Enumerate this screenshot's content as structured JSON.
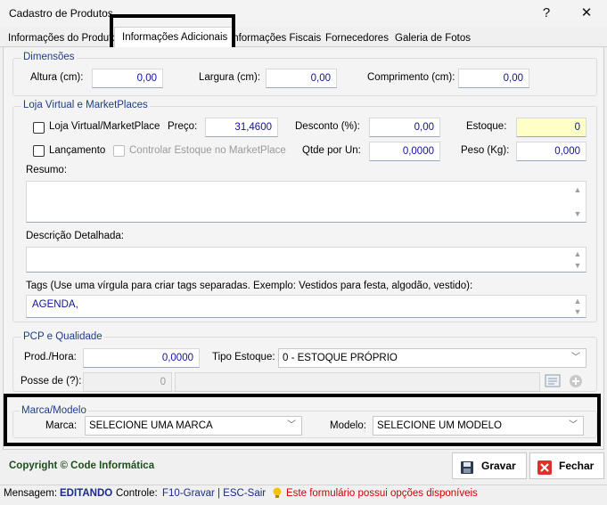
{
  "window": {
    "title": "Cadastro de Produtos",
    "help_label": "?",
    "close_label": "✕"
  },
  "tabs": [
    {
      "label": "Informações do Produto"
    },
    {
      "label": "Informações Adicionais",
      "active": true
    },
    {
      "label": "Informações Fiscais"
    },
    {
      "label": "Fornecedores"
    },
    {
      "label": "Galeria de Fotos"
    }
  ],
  "dimensoes": {
    "title": "Dimensões",
    "altura_label": "Altura (cm):",
    "altura_value": "0,00",
    "largura_label": "Largura (cm):",
    "largura_value": "0,00",
    "comprimento_label": "Comprimento (cm):",
    "comprimento_value": "0,00"
  },
  "loja": {
    "title": "Loja Virtual e MarketPlaces",
    "loja_virtual_label": "Loja Virtual/MarketPlace",
    "lancamento_label": "Lançamento",
    "controlar_estoque_label": "Controlar Estoque no MarketPlace",
    "preco_label": "Preço:",
    "preco_value": "31,4600",
    "desconto_label": "Desconto (%):",
    "desconto_value": "0,00",
    "estoque_label": "Estoque:",
    "estoque_value": "0",
    "qtde_label": "Qtde por Un:",
    "qtde_value": "0,0000",
    "peso_label": "Peso (Kg):",
    "peso_value": "0,000",
    "resumo_label": "Resumo:",
    "resumo_value": "",
    "descricao_label": "Descrição Detalhada:",
    "descricao_value": "",
    "tags_label": "Tags (Use uma vírgula para criar tags separadas. Exemplo: Vestidos para festa, algodão, vestido):",
    "tags_value": "AGENDA,"
  },
  "pcp": {
    "title": "PCP e Qualidade",
    "prod_hora_label": "Prod./Hora:",
    "prod_hora_value": "0,0000",
    "tipo_estoque_label": "Tipo Estoque:",
    "tipo_estoque_value": "0 - ESTOQUE PRÓPRIO",
    "posse_label": "Posse de (?):",
    "posse_value": "0",
    "posse_name": ""
  },
  "marca_modelo": {
    "title": "Marca/Modelo",
    "marca_label": "Marca:",
    "marca_value": "SELECIONE UMA MARCA",
    "modelo_label": "Modelo:",
    "modelo_value": "SELECIONE UM MODELO"
  },
  "footer": {
    "copyright": "Copyright © Code Informática",
    "gravar_label": "Gravar",
    "fechar_label": "Fechar"
  },
  "statusbar": {
    "mensagem_label": "Mensagem:",
    "mensagem_value": "EDITANDO",
    "controle_label": "Controle:",
    "controle_value": "F10-Gravar | ESC-Sair",
    "info_text": "Este formulário possui opções disponíveis"
  },
  "colors": {
    "legend": "#1f3c8a",
    "input_text": "#1010a0",
    "estoque_bg": "#ffffc8",
    "status_red": "#d00000",
    "copyright": "#1e4d1e"
  }
}
